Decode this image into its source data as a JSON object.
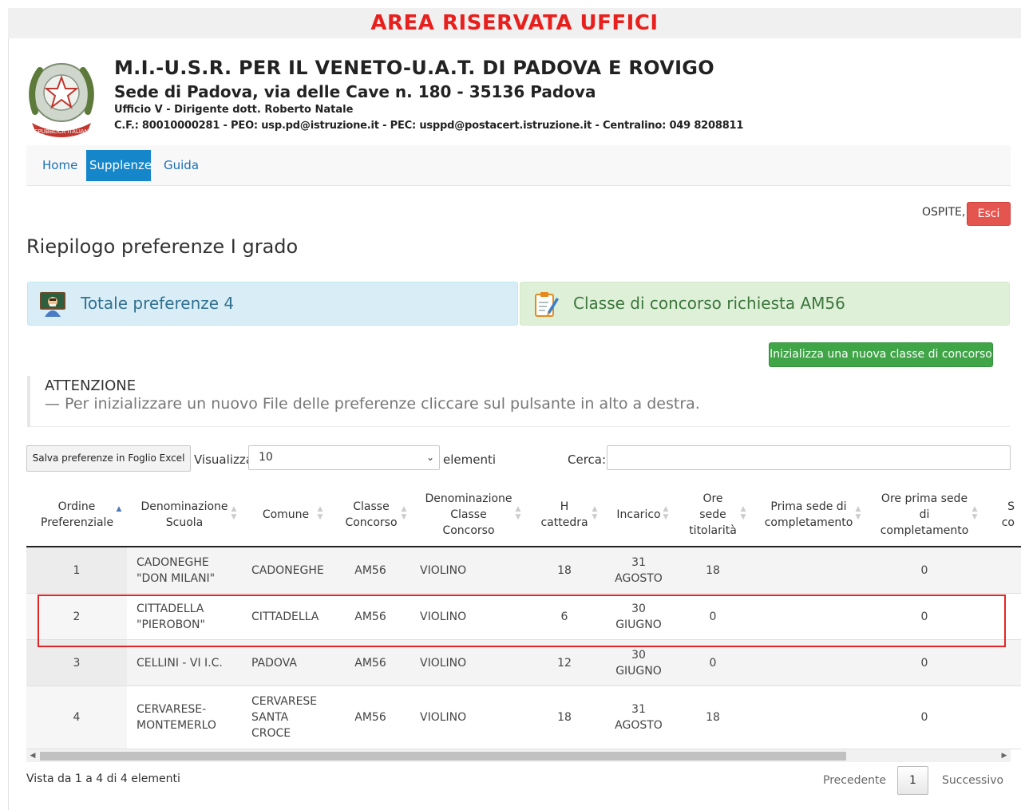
{
  "banner": "AREA RISERVATA UFFICI",
  "header": {
    "title": "M.I.-U.S.R. PER IL VENETO-U.A.T. DI PADOVA E ROVIGO",
    "subtitle": "Sede di Padova, via delle Cave n. 180 - 35136 Padova",
    "office": "Ufficio V - Dirigente dott. Roberto Natale",
    "contacts": "C.F.: 80010000281 - PEO: usp.pd@istruzione.it - PEC: usppd@postacert.istruzione.it - Centralino: 049 8208811"
  },
  "nav": {
    "items": [
      "Home",
      "Supplenze",
      "Guida"
    ],
    "active_index": 1
  },
  "user": {
    "label": "OSPITE,",
    "exit_label": "Esci"
  },
  "page_title": "Riepilogo preferenze I grado",
  "panels": {
    "total": "Totale preferenze 4",
    "class": "Classe di concorso richiesta AM56"
  },
  "new_class_button": "Inizializza una nuova classe di concorso",
  "warning": {
    "title": "ATTENZIONE",
    "text": "— Per inizializzare un nuovo File delle preferenze cliccare sul pulsante in alto a destra."
  },
  "toolbar": {
    "excel_button": "Salva preferenze in Foglio Excel",
    "show_label": "Visualizza",
    "page_length": "10",
    "elements_label": "elementi",
    "search_label": "Cerca:"
  },
  "table": {
    "headers": [
      "Ordine Preferenziale",
      "Denominazione Scuola",
      "Comune",
      "Classe Concorso",
      "Denominazione Classe Concorso",
      "H cattedra",
      "Incarico",
      "Ore sede titolarità",
      "Prima sede di completamento",
      "Ore prima sede di completamento",
      "S co"
    ],
    "rows": [
      {
        "ordine": "1",
        "scuola": "CADONEGHE \"DON MILANI\"",
        "comune": "CADONEGHE",
        "classe": "AM56",
        "denominazione": "VIOLINO",
        "h": "18",
        "incarico": "31 AGOSTO",
        "ore_sede": "18",
        "prima_sede": "",
        "ore_prima": "0"
      },
      {
        "ordine": "2",
        "scuola": "CITTADELLA \"PIEROBON\"",
        "comune": "CITTADELLA",
        "classe": "AM56",
        "denominazione": "VIOLINO",
        "h": "6",
        "incarico": "30 GIUGNO",
        "ore_sede": "0",
        "prima_sede": "",
        "ore_prima": "0"
      },
      {
        "ordine": "3",
        "scuola": "CELLINI - VI I.C.",
        "comune": "PADOVA",
        "classe": "AM56",
        "denominazione": "VIOLINO",
        "h": "12",
        "incarico": "30 GIUGNO",
        "ore_sede": "0",
        "prima_sede": "",
        "ore_prima": "0"
      },
      {
        "ordine": "4",
        "scuola": "CERVARESE-MONTEMERLO",
        "comune": "CERVARESE SANTA CROCE",
        "classe": "AM56",
        "denominazione": "VIOLINO",
        "h": "18",
        "incarico": "31 AGOSTO",
        "ore_sede": "18",
        "prima_sede": "",
        "ore_prima": "0"
      }
    ]
  },
  "footer": {
    "info": "Vista da 1 a 4 di 4 elementi",
    "prev": "Precedente",
    "page": "1",
    "next": "Successivo"
  },
  "icons": {
    "emblem": "italian-republic-emblem-icon",
    "total": "teacher-icon",
    "class": "clipboard-icon",
    "sort": "sort-arrows-icon"
  },
  "colors": {
    "banner_text": "#e8201d",
    "nav_active": "#1486c9",
    "exit_button": "#e5554f",
    "info_panel": "#d9edf7",
    "success_panel": "#dff0d8",
    "green_button": "#3fa547",
    "highlight": "#e32427"
  }
}
